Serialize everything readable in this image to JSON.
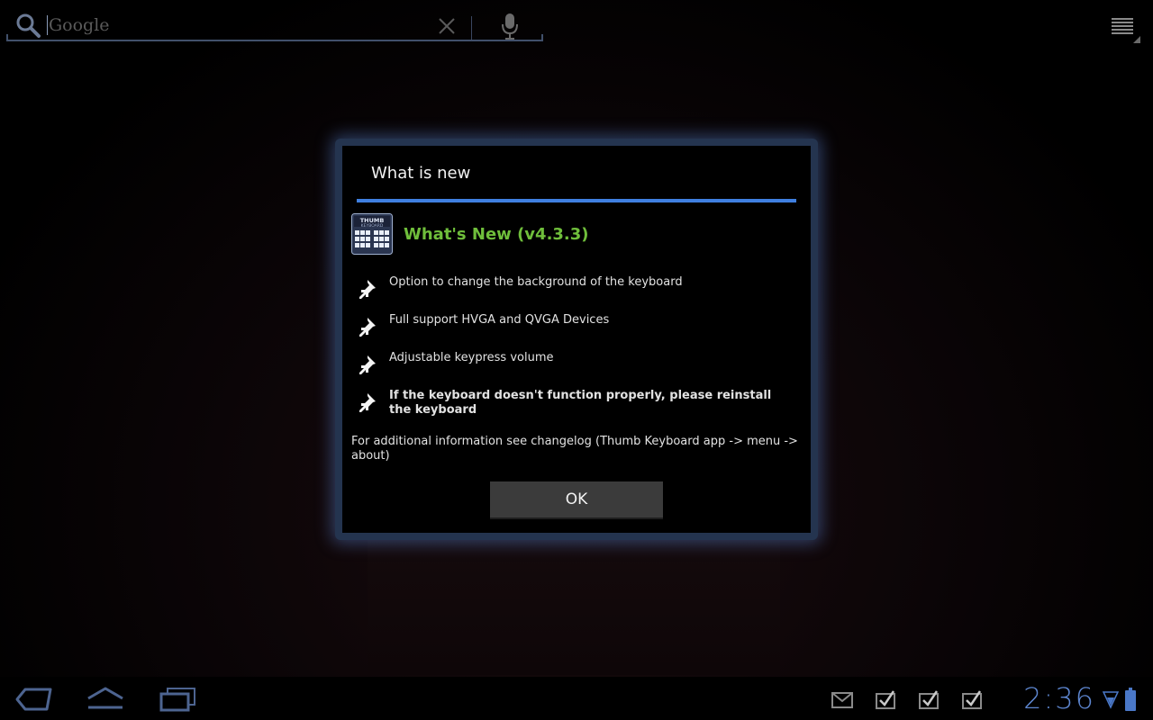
{
  "search": {
    "placeholder": "Google"
  },
  "dialog": {
    "title": "What is new",
    "heading": "What's New (v4.3.3)",
    "app_icon_label": "THUMB KEYBOARD",
    "items": [
      {
        "text": "Option to change the background of the keyboard",
        "bold": false
      },
      {
        "text": "Full support HVGA and QVGA Devices",
        "bold": false
      },
      {
        "text": "Adjustable keypress volume",
        "bold": false
      },
      {
        "text": "If the keyboard doesn't function properly, please reinstall the keyboard",
        "bold": true
      }
    ],
    "footer": "For additional information see changelog (Thumb Keyboard app -> menu -> about)",
    "ok_label": "OK"
  },
  "system_bar": {
    "time": "2:36",
    "notifications": [
      "gmail-icon",
      "task-complete-icon",
      "task-complete-icon",
      "task-complete-icon"
    ]
  },
  "colors": {
    "accent": "#3f7fe0",
    "heading_green": "#6fbe3b",
    "clock_blue": "#5d86d0"
  }
}
